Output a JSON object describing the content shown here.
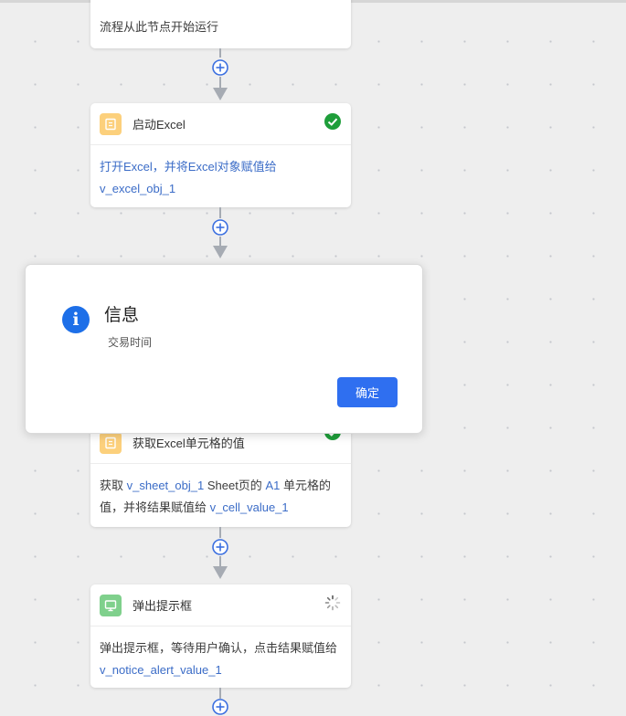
{
  "nodes": [
    {
      "body_text": "流程从此节点开始运行"
    },
    {
      "title": "启动Excel",
      "status": "success",
      "icon": "excel-file-icon",
      "desc_prefix": "打开Excel，并将Excel对象赋值给",
      "desc_var": "v_excel_obj_1"
    },
    {
      "title": "获取Excel单元格的值",
      "status": "success",
      "icon": "excel-file-icon",
      "desc_pre": "获取",
      "desc_var1": "v_sheet_obj_1",
      "desc_mid": " Sheet页的",
      "desc_cell": "A1",
      "desc_mid2": " 单元格的值，并将结果赋值给",
      "desc_var2": "v_cell_value_1"
    },
    {
      "title": "弹出提示框",
      "status": "running",
      "icon": "monitor-icon",
      "desc_prefix": "弹出提示框，等待用户确认，点击结果赋值给",
      "desc_var": "v_notice_alert_value_1"
    }
  ],
  "dialog": {
    "icon": "info-icon",
    "info_glyph": "i",
    "title": "信息",
    "message": "交易时间",
    "confirm_label": "确定"
  },
  "colors": {
    "accent": "#2f6ff0",
    "success": "#1e9e3a",
    "variable_link": "#3b6cc7",
    "connector": "#a6abb3",
    "connector_plus": "#3b6fe0"
  }
}
